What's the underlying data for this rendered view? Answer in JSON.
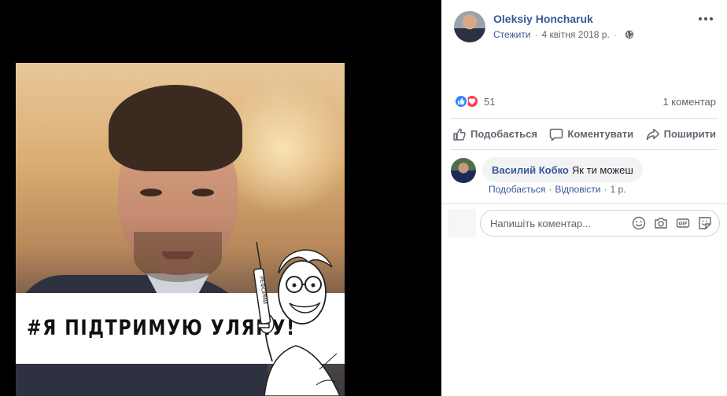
{
  "photo": {
    "banner_text": "#Я ПІДТРИМУЮ УЛЯНУ!",
    "syringe_text": "РЕФОРМИ"
  },
  "post": {
    "author": "Oleksiy Honcharuk",
    "follow_label": "Стежити",
    "date": "4 квітня 2018 р.",
    "reaction_count": "51",
    "comment_count": "1 коментар"
  },
  "actions": {
    "like": "Подобається",
    "comment": "Коментувати",
    "share": "Поширити"
  },
  "comment": {
    "author": "Василий Кобко",
    "text": "Як ти можеш",
    "like": "Подобається",
    "reply": "Відповісти",
    "time": "1 р."
  },
  "composer": {
    "placeholder": "Напишіть коментар..."
  },
  "colors": {
    "link": "#385898",
    "like_blue": "#2d88ff",
    "love_red": "#f33e58"
  },
  "icons": [
    "globe-icon",
    "more-icon",
    "like-icon",
    "comment-icon",
    "share-icon",
    "emoji-icon",
    "camera-icon",
    "gif-icon",
    "sticker-icon"
  ]
}
